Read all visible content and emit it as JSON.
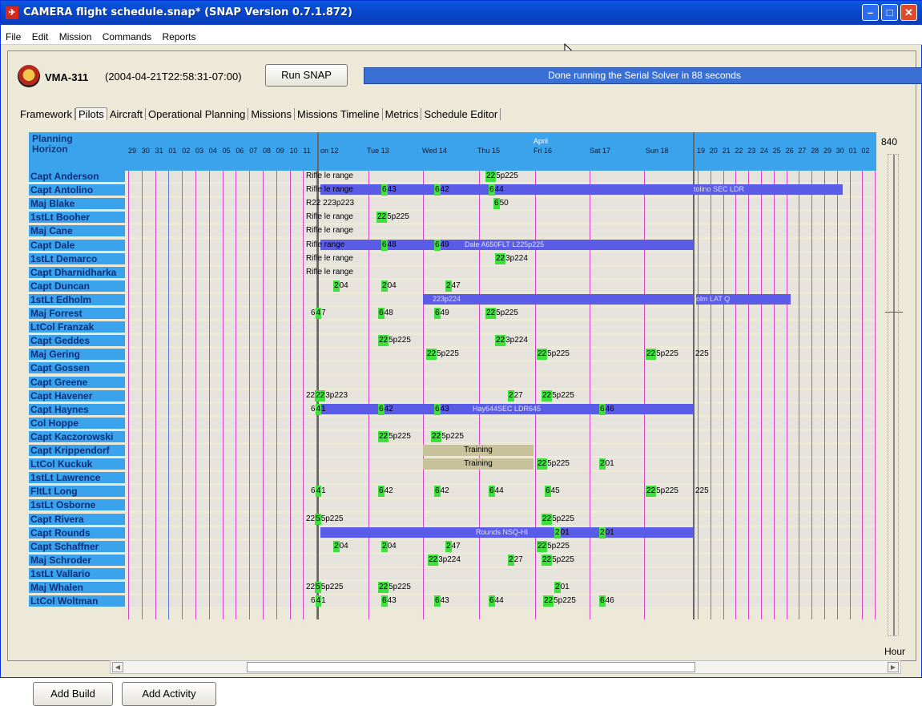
{
  "window": {
    "title": "CAMERA flight schedule.snap* (SNAP Version 0.7.1.872)"
  },
  "menu": [
    "File",
    "Edit",
    "Mission",
    "Commands",
    "Reports"
  ],
  "header": {
    "squadron": "VMA-311",
    "timestamp": "(2004-04-21T22:58:31-07:00)",
    "run_label": "Run SNAP",
    "status": "Done running the Serial Solver in 88 seconds"
  },
  "tabs": [
    "Framework",
    "Pilots",
    "Aircraft",
    "Operational Planning",
    "Missions",
    "Missions Timeline",
    "Metrics",
    "Schedule Editor"
  ],
  "active_tab": "Pilots",
  "planning": {
    "title": "Planning Horizon",
    "title_line1": "Planning",
    "title_line2": "Horizon",
    "month": "April",
    "left_days": [
      "29",
      "30",
      "31",
      "01",
      "02",
      "03",
      "04",
      "05",
      "06",
      "07",
      "08",
      "09",
      "10",
      "11"
    ],
    "main_days": [
      "on 12",
      "Tue 13",
      "Wed 14",
      "Thu 15",
      "Fri 16",
      "Sat 17",
      "Sun 18"
    ],
    "right_days": [
      "19",
      "20",
      "21",
      "22",
      "23",
      "24",
      "25",
      "26",
      "27",
      "28",
      "29",
      "30",
      "01",
      "02"
    ]
  },
  "pilots": [
    "Capt Anderson",
    "Capt Antolino",
    "Maj Blake",
    "1stLt Booher",
    "Maj Cane",
    "Capt Dale",
    "1stLt Demarco",
    "Capt Dharnidharka",
    "Capt Duncan",
    "1stLt Edholm",
    "Maj Forrest",
    "LtCol Franzak",
    "Capt Geddes",
    "Maj Gering",
    "Capt Gossen",
    "Capt Greene",
    "Capt Havener",
    "Capt Haynes",
    "Col Hoppe",
    "Capt Kaczorowski",
    "Capt Krippendorf",
    "LtCol Kuckuk",
    "1stLt Lawrence",
    "FltLt Long",
    "1stLt Osborne",
    "Capt Rivera",
    "Capt Rounds",
    "Capt Schaffner",
    "Maj Schroder",
    "1stLt Vallario",
    "Maj Whalen",
    "LtCol Woltman"
  ],
  "bars": [
    {
      "row": 1,
      "label": "tolino SEC LDR"
    },
    {
      "row": 5,
      "label": "Dale A650FLT L225p225"
    },
    {
      "row": 9,
      "label": "223p224"
    },
    {
      "row": 9,
      "label": "olm LAT Q"
    },
    {
      "row": 17,
      "label": "Hay644SEC LDR645"
    },
    {
      "row": 26,
      "label": "Rounds NSQ-HI"
    }
  ],
  "tan_bars": [
    {
      "row": 20,
      "label": "Training"
    },
    {
      "row": 21,
      "label": "Training"
    }
  ],
  "events": [
    {
      "row": 0,
      "pre": "Rifle ",
      "txt": "le range"
    },
    {
      "row": 0,
      "pre": "",
      "g": "22",
      "txt": "5p225"
    },
    {
      "row": 1,
      "pre": "Rifle ",
      "txt": "le range"
    },
    {
      "row": 1,
      "g": "6",
      "txt": "43"
    },
    {
      "row": 1,
      "g": "6",
      "txt": "42"
    },
    {
      "row": 1,
      "g": "6",
      "txt": "44"
    },
    {
      "row": 2,
      "pre": "R",
      "txt": "22 223p223"
    },
    {
      "row": 2,
      "g": "6",
      "txt": "50"
    },
    {
      "row": 3,
      "pre": "Rifle ",
      "txt": "le range"
    },
    {
      "row": 3,
      "g": "22",
      "txt": "5p225"
    },
    {
      "row": 4,
      "pre": "Rifle ",
      "txt": "le range"
    },
    {
      "row": 5,
      "pre": "Rifl",
      "txt": "e range"
    },
    {
      "row": 5,
      "g": "6",
      "txt": "48"
    },
    {
      "row": 5,
      "g": "6",
      "txt": "49"
    },
    {
      "row": 6,
      "pre": "Rifle ",
      "txt": "le range"
    },
    {
      "row": 6,
      "g": "22",
      "txt": "3p224"
    },
    {
      "row": 7,
      "pre": "Rifle ",
      "txt": "le range"
    },
    {
      "row": 8,
      "g": "2",
      "txt": "04"
    },
    {
      "row": 8,
      "g": "2",
      "txt": "04"
    },
    {
      "row": 8,
      "g": "2",
      "txt": "47"
    },
    {
      "row": 10,
      "pre": "6",
      "g": "4",
      "txt": "7"
    },
    {
      "row": 10,
      "g": "6",
      "txt": "48"
    },
    {
      "row": 10,
      "g": "6",
      "txt": "49"
    },
    {
      "row": 10,
      "g": "22",
      "txt": "5p225"
    },
    {
      "row": 12,
      "g": "22",
      "txt": "5p225"
    },
    {
      "row": 12,
      "g": "22",
      "txt": "3p224"
    },
    {
      "row": 13,
      "g": "22",
      "txt": "5p225"
    },
    {
      "row": 13,
      "g": "22",
      "txt": "5p225"
    },
    {
      "row": 13,
      "g": "22",
      "txt": "5p225"
    },
    {
      "row": 13,
      "txt": "225"
    },
    {
      "row": 16,
      "pre": "22",
      "g": "22",
      "txt": "3p223"
    },
    {
      "row": 16,
      "g": "2",
      "txt": "27"
    },
    {
      "row": 16,
      "g": "22",
      "txt": "5p225"
    },
    {
      "row": 17,
      "pre": "6",
      "g": "4",
      "txt": "1"
    },
    {
      "row": 17,
      "g": "6",
      "txt": "42"
    },
    {
      "row": 17,
      "g": "6",
      "txt": "43"
    },
    {
      "row": 17,
      "g": "6",
      "txt": "46"
    },
    {
      "row": 19,
      "g": "22",
      "txt": "5p225"
    },
    {
      "row": 19,
      "g": "22",
      "txt": "5p225"
    },
    {
      "row": 21,
      "g": "22",
      "txt": "5p225"
    },
    {
      "row": 21,
      "g": "2",
      "txt": "01"
    },
    {
      "row": 23,
      "pre": "6",
      "g": "4",
      "txt": "1"
    },
    {
      "row": 23,
      "g": "6",
      "txt": "42"
    },
    {
      "row": 23,
      "g": "6",
      "txt": "42"
    },
    {
      "row": 23,
      "g": "6",
      "txt": "44"
    },
    {
      "row": 23,
      "g": "6",
      "txt": "45"
    },
    {
      "row": 23,
      "g": "22",
      "txt": "5p225"
    },
    {
      "row": 23,
      "txt": "225"
    },
    {
      "row": 25,
      "pre": "22",
      "g": "5",
      "txt": "5p225"
    },
    {
      "row": 25,
      "g": "22",
      "txt": "5p225"
    },
    {
      "row": 26,
      "g": "2",
      "txt": "01"
    },
    {
      "row": 26,
      "g": "2",
      "txt": "01"
    },
    {
      "row": 27,
      "g": "2",
      "txt": "04"
    },
    {
      "row": 27,
      "g": "2",
      "txt": "04"
    },
    {
      "row": 27,
      "g": "2",
      "txt": "47"
    },
    {
      "row": 27,
      "g": "22",
      "txt": "5p225"
    },
    {
      "row": 28,
      "g": "22",
      "txt": "3p224"
    },
    {
      "row": 28,
      "g": "2",
      "txt": "27"
    },
    {
      "row": 28,
      "g": "22",
      "txt": "5p225"
    },
    {
      "row": 30,
      "pre": "22",
      "g": "5",
      "txt": "5p225"
    },
    {
      "row": 30,
      "g": "22",
      "txt": "5p225"
    },
    {
      "row": 30,
      "g": "2",
      "txt": "01"
    },
    {
      "row": 31,
      "pre": "6",
      "g": "4",
      "txt": "1"
    },
    {
      "row": 31,
      "g": "6",
      "txt": "43"
    },
    {
      "row": 31,
      "g": "6",
      "txt": "43"
    },
    {
      "row": 31,
      "g": "6",
      "txt": "44"
    },
    {
      "row": 31,
      "g": "22",
      "txt": "5p225"
    },
    {
      "row": 31,
      "g": "6",
      "txt": "46"
    }
  ],
  "side": {
    "value": "840",
    "unit": "Hour"
  },
  "buttons": {
    "add_build": "Add Build",
    "add_activity": "Add Activity"
  },
  "colors": {
    "accent": "#3ba2ec",
    "bar": "#5a5be6",
    "event": "#3ee03e",
    "gridline": "#d546c9"
  }
}
